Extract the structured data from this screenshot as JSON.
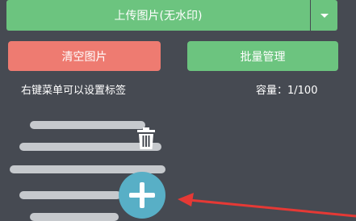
{
  "toolbar": {
    "upload_label": "上传图片(无水印)",
    "clear_label": "清空图片",
    "batch_label": "批量管理"
  },
  "info": {
    "hint": "右键菜单可以设置标签",
    "capacity": "容量：1/100"
  },
  "icons": {
    "dropdown": "chevron-down-icon",
    "trash": "trash-icon",
    "add": "plus-icon",
    "annotation": "red-arrow"
  },
  "colors": {
    "green": "#6cc47f",
    "red": "#ee7b71",
    "teal": "#58afc6",
    "arrow_red": "#e53935",
    "background": "#464a52"
  }
}
